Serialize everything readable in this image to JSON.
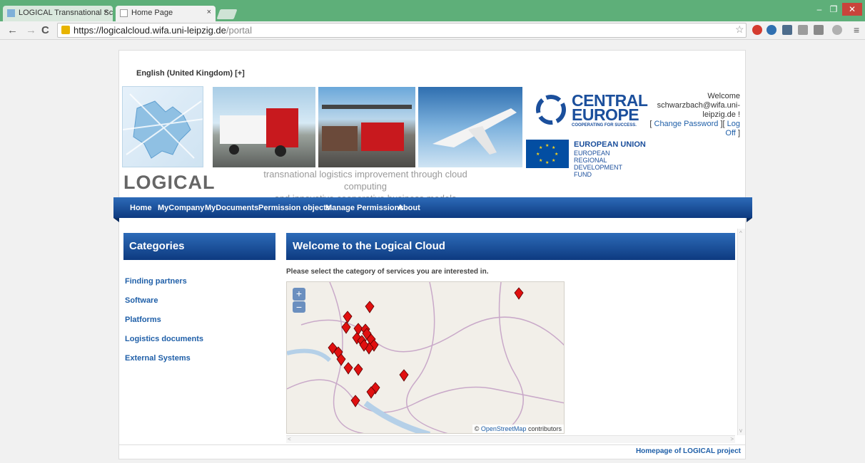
{
  "browser": {
    "tabs": [
      {
        "title": "LOGICAL Transnational Sc",
        "close": "×"
      },
      {
        "title": "Home Page",
        "close": "×"
      }
    ],
    "window": {
      "minimize": "–",
      "maximize": "❐",
      "close": "✕"
    },
    "nav": {
      "back": "←",
      "forward": "→",
      "reload": "C",
      "menu": "≡",
      "star": "☆"
    },
    "url": {
      "host": "https://logicalcloud.wifa.uni-leipzig.de",
      "path": "/portal"
    }
  },
  "header": {
    "language": "English (United Kingdom) [+]",
    "logo_text": "LOGICAL",
    "tagline_line1": "transnational logistics improvement through cloud computing",
    "tagline_line2": "and innovative cooperative business models",
    "central_europe": {
      "line1": "CENTRAL",
      "line2": "EUROPE",
      "sub": "COOPERATING FOR SUCCESS."
    },
    "eu": {
      "title": "EUROPEAN UNION",
      "sub": "EUROPEAN REGIONAL DEVELOPMENT FUND"
    },
    "welcome": {
      "greeting": "Welcome",
      "user": "schwarzbach@wifa.uni-leipzig.de !",
      "change_password": "Change Password",
      "log_off": "Log Off",
      "bracket_open": "[",
      "bracket_close": "]"
    }
  },
  "menu": [
    "Home",
    "MyCompany",
    "MyDocuments",
    "Permission objects",
    "Manage Permissions",
    "About"
  ],
  "sidebar": {
    "title": "Categories",
    "items": [
      "Finding partners",
      "Software",
      "Platforms",
      "Logistics documents",
      "External Systems"
    ]
  },
  "main": {
    "title": "Welcome to the Logical Cloud",
    "instruction": "Please select the category of services you are interested in.",
    "map": {
      "zoom_in": "+",
      "zoom_out": "−",
      "credit_symbol": "©",
      "credit_link": "OpenStreetMap",
      "credit_suffix": "contributors",
      "marker_color": "#e01010"
    }
  },
  "footer": {
    "link": "Homepage of LOGICAL project"
  },
  "colors": {
    "accent": "#1b4f9c",
    "menubar": "#0d3a80",
    "link": "#1f5fa8"
  }
}
